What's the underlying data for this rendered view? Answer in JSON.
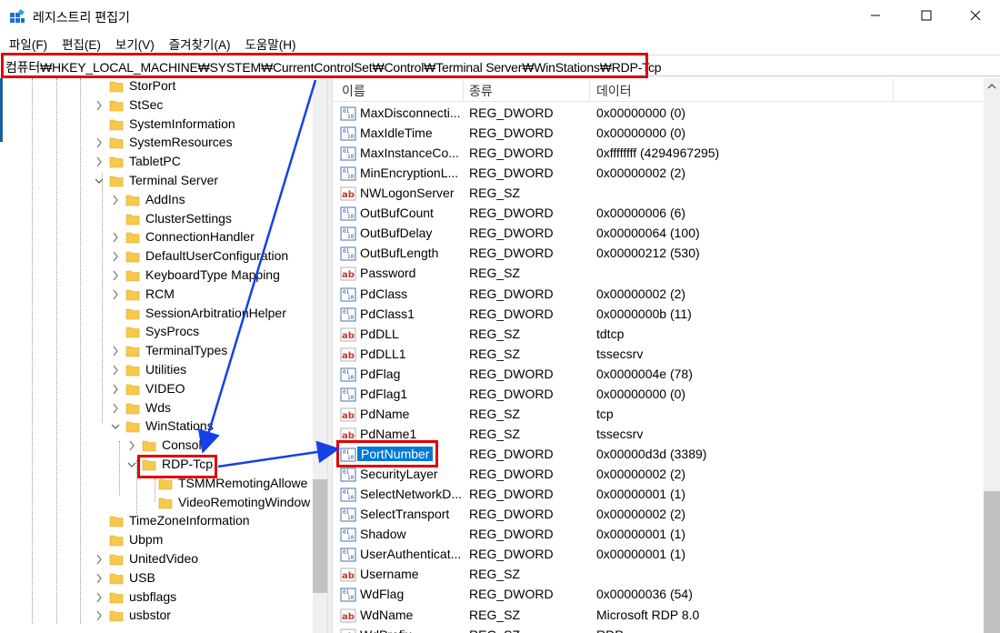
{
  "window": {
    "title": "레지스트리 편집기",
    "minimize_glyph": "—",
    "maximize_glyph": "☐",
    "close_glyph": "✕"
  },
  "menu": [
    "파일(F)",
    "편집(E)",
    "보기(V)",
    "즐겨찾기(A)",
    "도움말(H)"
  ],
  "address": "컴퓨터₩HKEY_LOCAL_MACHINE₩SYSTEM₩CurrentControlSet₩Control₩Terminal Server₩WinStations₩RDP-Tcp",
  "tree": [
    {
      "label": "StorPort",
      "level": 0,
      "expander": "none"
    },
    {
      "label": "StSec",
      "level": 0,
      "expander": "collapsed"
    },
    {
      "label": "SystemInformation",
      "level": 0,
      "expander": "none"
    },
    {
      "label": "SystemResources",
      "level": 0,
      "expander": "collapsed"
    },
    {
      "label": "TabletPC",
      "level": 0,
      "expander": "collapsed"
    },
    {
      "label": "Terminal Server",
      "level": 0,
      "expander": "expanded"
    },
    {
      "label": "AddIns",
      "level": 1,
      "expander": "collapsed"
    },
    {
      "label": "ClusterSettings",
      "level": 1,
      "expander": "none"
    },
    {
      "label": "ConnectionHandler",
      "level": 1,
      "expander": "collapsed"
    },
    {
      "label": "DefaultUserConfiguration",
      "level": 1,
      "expander": "collapsed"
    },
    {
      "label": "KeyboardType Mapping",
      "level": 1,
      "expander": "collapsed"
    },
    {
      "label": "RCM",
      "level": 1,
      "expander": "collapsed"
    },
    {
      "label": "SessionArbitrationHelper",
      "level": 1,
      "expander": "none"
    },
    {
      "label": "SysProcs",
      "level": 1,
      "expander": "none"
    },
    {
      "label": "TerminalTypes",
      "level": 1,
      "expander": "collapsed"
    },
    {
      "label": "Utilities",
      "level": 1,
      "expander": "collapsed"
    },
    {
      "label": "VIDEO",
      "level": 1,
      "expander": "collapsed"
    },
    {
      "label": "Wds",
      "level": 1,
      "expander": "collapsed"
    },
    {
      "label": "WinStations",
      "level": 1,
      "expander": "expanded"
    },
    {
      "label": "Console",
      "level": 2,
      "expander": "collapsed"
    },
    {
      "label": "RDP-Tcp",
      "level": 2,
      "expander": "expanded",
      "selected": true
    },
    {
      "label": "TSMMRemotingAllowe",
      "level": 3,
      "expander": "none"
    },
    {
      "label": "VideoRemotingWindow",
      "level": 3,
      "expander": "none"
    },
    {
      "label": "TimeZoneInformation",
      "level": 0,
      "expander": "none"
    },
    {
      "label": "Ubpm",
      "level": 0,
      "expander": "none"
    },
    {
      "label": "UnitedVideo",
      "level": 0,
      "expander": "collapsed"
    },
    {
      "label": "USB",
      "level": 0,
      "expander": "collapsed"
    },
    {
      "label": "usbflags",
      "level": 0,
      "expander": "collapsed"
    },
    {
      "label": "usbstor",
      "level": 0,
      "expander": "collapsed"
    }
  ],
  "list": {
    "headers": {
      "name": "이름",
      "type": "종류",
      "data": "데이터"
    },
    "rows": [
      {
        "name": "MaxDisconnecti...",
        "type": "REG_DWORD",
        "data": "0x00000000 (0)",
        "icon": "binary"
      },
      {
        "name": "MaxIdleTime",
        "type": "REG_DWORD",
        "data": "0x00000000 (0)",
        "icon": "binary"
      },
      {
        "name": "MaxInstanceCo...",
        "type": "REG_DWORD",
        "data": "0xffffffff (4294967295)",
        "icon": "binary"
      },
      {
        "name": "MinEncryptionL...",
        "type": "REG_DWORD",
        "data": "0x00000002 (2)",
        "icon": "binary"
      },
      {
        "name": "NWLogonServer",
        "type": "REG_SZ",
        "data": "",
        "icon": "string"
      },
      {
        "name": "OutBufCount",
        "type": "REG_DWORD",
        "data": "0x00000006 (6)",
        "icon": "binary"
      },
      {
        "name": "OutBufDelay",
        "type": "REG_DWORD",
        "data": "0x00000064 (100)",
        "icon": "binary"
      },
      {
        "name": "OutBufLength",
        "type": "REG_DWORD",
        "data": "0x00000212 (530)",
        "icon": "binary"
      },
      {
        "name": "Password",
        "type": "REG_SZ",
        "data": "",
        "icon": "string"
      },
      {
        "name": "PdClass",
        "type": "REG_DWORD",
        "data": "0x00000002 (2)",
        "icon": "binary"
      },
      {
        "name": "PdClass1",
        "type": "REG_DWORD",
        "data": "0x0000000b (11)",
        "icon": "binary"
      },
      {
        "name": "PdDLL",
        "type": "REG_SZ",
        "data": "tdtcp",
        "icon": "string"
      },
      {
        "name": "PdDLL1",
        "type": "REG_SZ",
        "data": "tssecsrv",
        "icon": "string"
      },
      {
        "name": "PdFlag",
        "type": "REG_DWORD",
        "data": "0x0000004e (78)",
        "icon": "binary"
      },
      {
        "name": "PdFlag1",
        "type": "REG_DWORD",
        "data": "0x00000000 (0)",
        "icon": "binary"
      },
      {
        "name": "PdName",
        "type": "REG_SZ",
        "data": "tcp",
        "icon": "string"
      },
      {
        "name": "PdName1",
        "type": "REG_SZ",
        "data": "tssecsrv",
        "icon": "string"
      },
      {
        "name": "PortNumber",
        "type": "REG_DWORD",
        "data": "0x00000d3d (3389)",
        "icon": "binary",
        "selected": true
      },
      {
        "name": "SecurityLayer",
        "type": "REG_DWORD",
        "data": "0x00000002 (2)",
        "icon": "binary"
      },
      {
        "name": "SelectNetworkD...",
        "type": "REG_DWORD",
        "data": "0x00000001 (1)",
        "icon": "binary"
      },
      {
        "name": "SelectTransport",
        "type": "REG_DWORD",
        "data": "0x00000002 (2)",
        "icon": "binary"
      },
      {
        "name": "Shadow",
        "type": "REG_DWORD",
        "data": "0x00000001 (1)",
        "icon": "binary"
      },
      {
        "name": "UserAuthenticat...",
        "type": "REG_DWORD",
        "data": "0x00000001 (1)",
        "icon": "binary"
      },
      {
        "name": "Username",
        "type": "REG_SZ",
        "data": "",
        "icon": "string"
      },
      {
        "name": "WdFlag",
        "type": "REG_DWORD",
        "data": "0x00000036 (54)",
        "icon": "binary"
      },
      {
        "name": "WdName",
        "type": "REG_SZ",
        "data": "Microsoft RDP 8.0",
        "icon": "string"
      },
      {
        "name": "WdPrefix",
        "type": "REG_SZ",
        "data": "RDP",
        "icon": "string"
      }
    ]
  },
  "colors": {
    "selection": "#0078d7",
    "highlight_box": "#e00000",
    "arrow": "#1540e8",
    "folder": "#f6c94a"
  }
}
